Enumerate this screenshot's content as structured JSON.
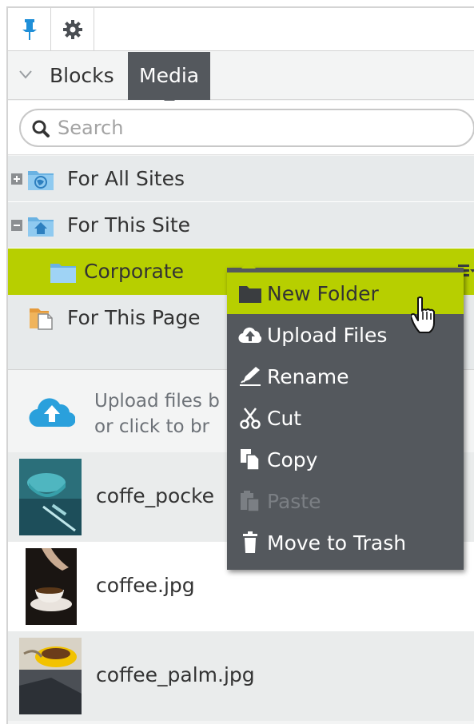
{
  "toolbar": {
    "pin_icon": "pin-icon",
    "settings_icon": "gear-icon"
  },
  "tabs": {
    "items": [
      {
        "label": "Blocks",
        "active": false
      },
      {
        "label": "Media",
        "active": true
      }
    ]
  },
  "search": {
    "placeholder": "Search",
    "value": ""
  },
  "tree": {
    "nodes": [
      {
        "label": "For All Sites",
        "expanded": false,
        "icon": "globe-folder-icon"
      },
      {
        "label": "For This Site",
        "expanded": true,
        "icon": "home-folder-icon"
      },
      {
        "label": "Corporate",
        "selected": true,
        "icon": "folder-icon"
      },
      {
        "label": "For This Page",
        "icon": "page-folder-icon"
      }
    ]
  },
  "uploader": {
    "line1": "Upload files b",
    "line2": "or click to br"
  },
  "media": {
    "items": [
      {
        "name": "coffe_pocke"
      },
      {
        "name": "coffee.jpg"
      },
      {
        "name": "coffee_palm.jpg"
      }
    ]
  },
  "context_menu": {
    "items": [
      {
        "label": "New Folder",
        "icon": "folder-icon",
        "state": "hover"
      },
      {
        "label": "Upload Files",
        "icon": "cloud-upload-icon",
        "state": "normal"
      },
      {
        "label": "Rename",
        "icon": "rename-icon",
        "state": "normal"
      },
      {
        "label": "Cut",
        "icon": "scissors-icon",
        "state": "normal"
      },
      {
        "label": "Copy",
        "icon": "copy-icon",
        "state": "normal"
      },
      {
        "label": "Paste",
        "icon": "paste-icon",
        "state": "disabled"
      },
      {
        "label": "Move to Trash",
        "icon": "trash-icon",
        "state": "normal"
      }
    ]
  },
  "colors": {
    "accent": "#b7cf00",
    "menu_bg": "#54585d",
    "link_blue": "#2aa0dc"
  }
}
